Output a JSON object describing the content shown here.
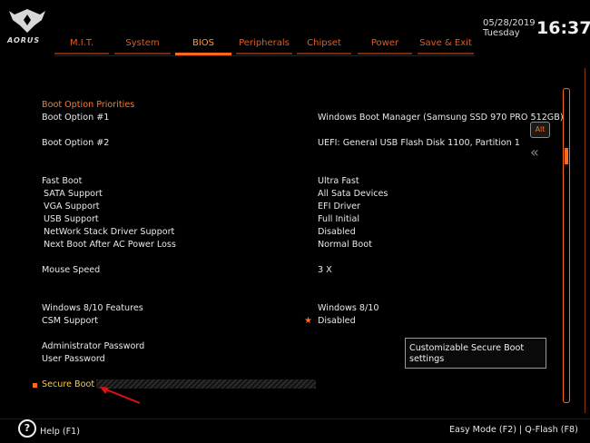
{
  "brand": {
    "name": "AORUS"
  },
  "datetime": {
    "date": "05/28/2019",
    "day": "Tuesday",
    "time": "16:37"
  },
  "tabs": [
    {
      "label": "M.I.T."
    },
    {
      "label": "System"
    },
    {
      "label": "BIOS",
      "active": true
    },
    {
      "label": "Peripherals"
    },
    {
      "label": "Chipset"
    },
    {
      "label": "Power"
    },
    {
      "label": "Save & Exit"
    }
  ],
  "settings": {
    "boot_option_priorities": "Boot Option Priorities",
    "boot_option_1": {
      "label": "Boot Option #1",
      "value": "Windows Boot Manager (Samsung SSD 970 PRO 512GB)"
    },
    "boot_option_2": {
      "label": "Boot Option #2",
      "value": "UEFI: General USB Flash Disk 1100, Partition 1"
    },
    "fast_boot": {
      "label": "Fast Boot",
      "value": "Ultra Fast"
    },
    "sata_support": {
      "label": "SATA Support",
      "value": "All Sata Devices"
    },
    "vga_support": {
      "label": "VGA Support",
      "value": "EFI Driver"
    },
    "usb_support": {
      "label": "USB Support",
      "value": "Full Initial"
    },
    "network_stack": {
      "label": "NetWork Stack Driver Support",
      "value": "Disabled"
    },
    "next_boot_ac": {
      "label": "Next Boot After AC Power Loss",
      "value": "Normal Boot"
    },
    "mouse_speed": {
      "label": "Mouse Speed",
      "value": "3 X"
    },
    "win_features": {
      "label": "Windows 8/10 Features",
      "value": "Windows 8/10"
    },
    "csm_support": {
      "label": "CSM Support",
      "value": "Disabled"
    },
    "admin_password": {
      "label": "Administrator Password"
    },
    "user_password": {
      "label": "User Password"
    },
    "secure_boot": {
      "label": "Secure Boot"
    }
  },
  "side": {
    "alt_label": "Alt",
    "collapse_glyph": "«"
  },
  "tooltip": {
    "line1": "Customizable Secure Boot",
    "line2": "settings"
  },
  "footer": {
    "help": "Help (F1)",
    "help_icon": "?",
    "easy_mode": "Easy Mode (F2)  |  Q-Flash (F8)"
  },
  "colors": {
    "accent": "#ff6a1a",
    "selected": "#ffcc33",
    "heading": "#ff7a2a"
  },
  "scrollbar": {
    "position_fraction": 0.2
  }
}
